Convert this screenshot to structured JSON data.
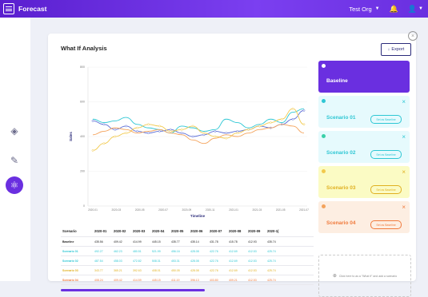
{
  "header": {
    "app_title": "Forecast",
    "org": "Test Org"
  },
  "card": {
    "title": "What If Analysis",
    "export_label": "Export"
  },
  "chart_data": {
    "type": "line",
    "xlabel": "Timeline",
    "ylabel": "Sales",
    "x_ticks": [
      "2020-01",
      "2020-03",
      "2020-05",
      "2020-07",
      "2020-09",
      "2020-11",
      "2021-01",
      "2021-03",
      "2021-05",
      "2021-07"
    ],
    "y_ticks": [
      "800",
      "600",
      "400",
      "200",
      "0"
    ],
    "ylim": [
      0,
      800
    ],
    "series": [
      {
        "color": "#5b6dd6",
        "values": [
          490,
          470,
          440,
          460,
          430,
          420,
          430,
          440,
          420,
          400,
          410,
          430,
          420,
          430,
          440,
          460,
          450,
          470,
          500,
          550
        ]
      },
      {
        "color": "#2ec7d4",
        "values": [
          500,
          480,
          490,
          510,
          470,
          450,
          440,
          420,
          460,
          450,
          430,
          440,
          500,
          480,
          450,
          470,
          500,
          480,
          540,
          560
        ]
      },
      {
        "color": "#f2c94c",
        "values": [
          320,
          360,
          400,
          420,
          450,
          470,
          460,
          430,
          440,
          460,
          420,
          400,
          390,
          420,
          440,
          460,
          480,
          500,
          560,
          470
        ]
      },
      {
        "color": "#f4a35c",
        "values": [
          410,
          430,
          450,
          440,
          420,
          430,
          440,
          420,
          410,
          380,
          360,
          390,
          410,
          400,
          420,
          440,
          450,
          470,
          460,
          420
        ]
      }
    ]
  },
  "table": {
    "headers": [
      "Scenario",
      "2020-01",
      "2020-02",
      "2020-03",
      "2020-04",
      "2020-05",
      "2020-06",
      "2020-07",
      "2020-08",
      "2020-09",
      "2020-1("
    ],
    "rows": [
      {
        "name": "Baseline",
        "color": "#222222",
        "values": [
          "435.56",
          "409.42",
          "414.99",
          "445.15",
          "435.77",
          "435.14",
          "431.78",
          "415.78",
          "412.93",
          "435.74"
        ]
      },
      {
        "name": "Scenario 01",
        "color": "#2ec7d4",
        "values": [
          "492.27",
          "462.23",
          "480.51",
          "521.99",
          "456.16",
          "428.08",
          "422.76",
          "412.69",
          "412.53",
          "425.74"
        ]
      },
      {
        "name": "Scenario 02",
        "color": "#2ec7d4",
        "values": [
          "487.54",
          "458.03",
          "472.82",
          "508.31",
          "453.31",
          "428.08",
          "422.76",
          "412.69",
          "412.53",
          "425.74"
        ]
      },
      {
        "name": "Scenario 03",
        "color": "#e0b020",
        "values": [
          "343.77",
          "365.21",
          "392.63",
          "408.01",
          "450.05",
          "428.08",
          "422.76",
          "412.69",
          "412.53",
          "425.74"
        ]
      },
      {
        "name": "Scenario 04",
        "color": "#f07a3c",
        "values": [
          "408.24",
          "409.42",
          "414.59",
          "445.15",
          "411.19",
          "396.13",
          "403.80",
          "409.21",
          "412.53",
          "425.74"
        ]
      }
    ]
  },
  "panels": [
    {
      "name": "Baseline",
      "bg": "#6a2fe0",
      "fg": "#ffffff",
      "dot": "#ffffff",
      "set": ""
    },
    {
      "name": "Scenario 01",
      "bg": "#e6fafd",
      "fg": "#2ec7d4",
      "dot": "#2ec7d4",
      "set": "Set as Baseline"
    },
    {
      "name": "Scenario 02",
      "bg": "#e6fafd",
      "fg": "#2ec7d4",
      "dot": "#3ad0a8",
      "set": "Set as Baseline"
    },
    {
      "name": "Scenario 03",
      "bg": "#fbfbc4",
      "fg": "#e0b020",
      "dot": "#f2c94c",
      "set": "Set as Baseline"
    },
    {
      "name": "Scenario 04",
      "bg": "#fdeee2",
      "fg": "#f07a3c",
      "dot": "#f4a35c",
      "set": "Set as Baseline"
    }
  ],
  "add_scenario_text": "Click here to as a \"What If\" and add a scenario"
}
